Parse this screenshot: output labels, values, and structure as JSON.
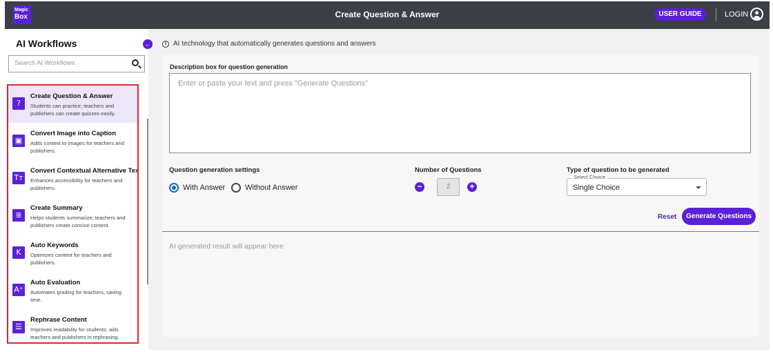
{
  "header": {
    "logo_line1": "Magic",
    "logo_line2": "Box",
    "title": "Create Question & Answer",
    "user_guide": "USER GUIDE",
    "login": "LOGIN"
  },
  "sidebar": {
    "title": "AI Workflows",
    "search_placeholder": "Search AI Workflows",
    "items": [
      {
        "title": "Create Question & Answer",
        "desc": "Students can practice; teachers and publishers can create quizzes easily.",
        "icon": "?",
        "active": true
      },
      {
        "title": "Convert Image into Caption",
        "desc": "Adds context to images for teachers and publishers.",
        "icon": "▣",
        "active": false
      },
      {
        "title": "Convert Contextual Alternative Text",
        "desc": "Enhances accessibility for teachers and publishers.",
        "icon": "Tт",
        "active": false
      },
      {
        "title": "Create Summary",
        "desc": "Helps students summarize; teachers and publishers create concise content.",
        "icon": "≣",
        "active": false
      },
      {
        "title": "Auto Keywords",
        "desc": "Optimizes content for teachers and publishers.",
        "icon": "K",
        "active": false
      },
      {
        "title": "Auto Evaluation",
        "desc": "Automates grading for teachers, saving time.",
        "icon": "A⁺",
        "active": false
      },
      {
        "title": "Rephrase Content",
        "desc": "Improves readability for students; aids teachers and publishers in rephrasing.",
        "icon": "☰",
        "active": false
      }
    ]
  },
  "main": {
    "info": "AI technology that automatically generates questions and answers",
    "description_label": "Description box for question generation",
    "description_placeholder": "Enter or paste your text and press \"Generate Questions\"",
    "settings_label": "Question generation settings",
    "radio_with": "With Answer",
    "radio_without": "Without Answer",
    "num_label": "Number of Questions",
    "num_value": "2",
    "type_label": "Type of question to be generated",
    "select_legend": "Select Choice",
    "select_value": "Single Choice",
    "reset": "Reset",
    "generate": "Generate Questions",
    "result_placeholder": "AI generated result will appear here"
  },
  "colors": {
    "accent": "#5b21d6",
    "header_bg": "#3c3f45",
    "active_item_bg": "#ece6f8",
    "highlight_border": "#e0252f"
  }
}
